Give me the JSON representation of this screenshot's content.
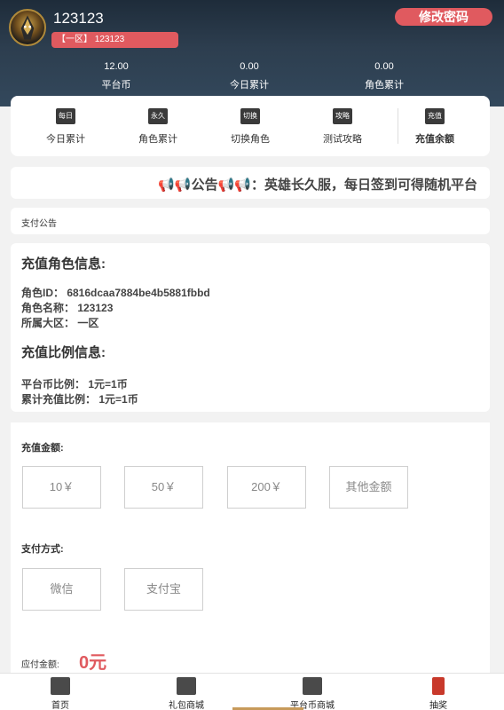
{
  "header": {
    "username": "123123",
    "server_badge": "【一区】 123123",
    "change_password": "修改密码",
    "stats": [
      {
        "value": "12.00",
        "label": "平台币"
      },
      {
        "value": "0.00",
        "label": "今日累计"
      },
      {
        "value": "0.00",
        "label": "角色累计"
      }
    ]
  },
  "quicknav": [
    {
      "icon": "每日",
      "label": "今日累计"
    },
    {
      "icon": "永久",
      "label": "角色累计"
    },
    {
      "icon": "切换",
      "label": "切换角色"
    },
    {
      "icon": "攻略",
      "label": "测试攻略"
    },
    {
      "icon": "充值",
      "label": "充值余额"
    }
  ],
  "notice": {
    "prefix": "📢📢",
    "word": "公告",
    "suffix": "📢📢",
    "text": "：英雄长久服，每日签到可得随机平台"
  },
  "pay_notice": "支付公告",
  "info": {
    "role_title": "充值角色信息:",
    "role_id": "角色ID：  6816dcaa7884be4b5881fbbd",
    "role_name": "角色名称：  123123",
    "role_server": "所属大区：  一区",
    "ratio_title": "充值比例信息:",
    "platform_ratio": "平台币比例：  1元=1币",
    "total_ratio": "累计充值比例：  1元=1币"
  },
  "form": {
    "amount_label": "充值金额:",
    "amounts": [
      "10￥",
      "50￥",
      "200￥",
      "其他金额"
    ],
    "method_label": "支付方式:",
    "methods": [
      "微信",
      "支付宝"
    ],
    "payable_label": "应付金额:",
    "payable_value": "0元"
  },
  "bottomnav": [
    {
      "label": "首页",
      "icon": "home-icon"
    },
    {
      "label": "礼包商城",
      "icon": "gift-icon"
    },
    {
      "label": "平台币商城",
      "icon": "coin-store-icon"
    },
    {
      "label": "抽奖",
      "icon": "lottery-icon"
    }
  ]
}
